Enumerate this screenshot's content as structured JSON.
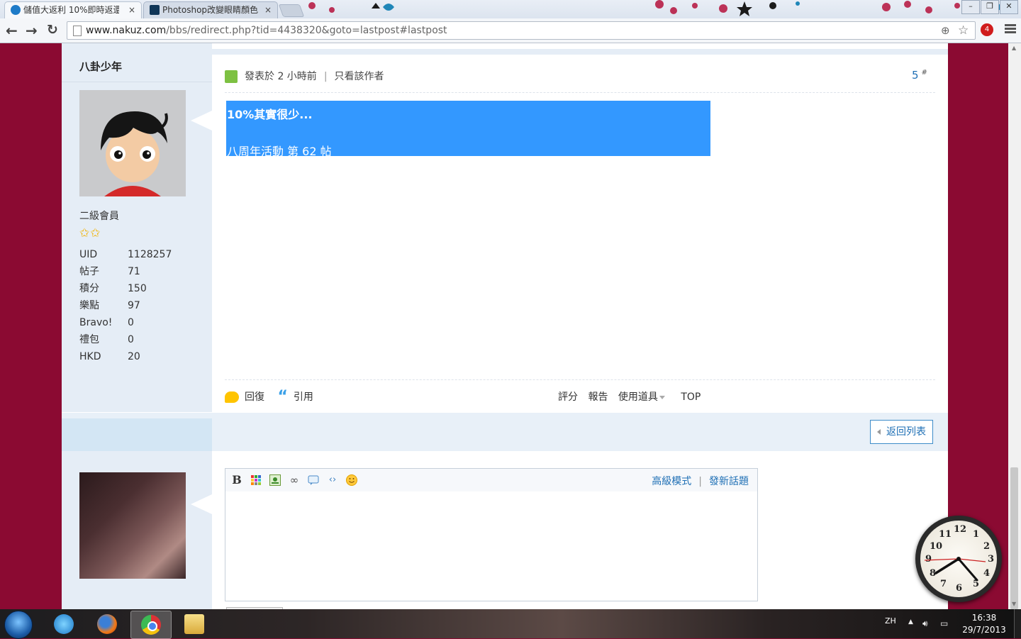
{
  "browser": {
    "tabs": [
      {
        "label": "儲值大返利 10%即時返還",
        "close": "×"
      },
      {
        "label": "Photoshop改變眼睛顏色",
        "close": "×"
      }
    ],
    "window_buttons": {
      "minimize": "–",
      "restore": "❐",
      "close": "✕"
    },
    "url_host": "www.nakuz.com",
    "url_path": "/bbs/redirect.php?tid=4438320&goto=lastpost#lastpost",
    "extension_badge": "4"
  },
  "post": {
    "author": "八卦少年",
    "rank": "二級會員",
    "stars": "✩✩",
    "stats": [
      {
        "key": "UID",
        "value": "1128257"
      },
      {
        "key": "帖子",
        "value": "71"
      },
      {
        "key": "積分",
        "value": "150"
      },
      {
        "key": "樂點",
        "value": "97"
      },
      {
        "key": "Bravo!",
        "value": "0"
      },
      {
        "key": "禮包",
        "value": "0"
      },
      {
        "key": "HKD",
        "value": "20"
      }
    ],
    "posted_at": "發表於 2 小時前",
    "only_author": "只看該作者",
    "floor": "5",
    "floor_mark": "#",
    "body_line1": "10%其實很少...",
    "body_line2": "八周年活動 第 62 帖",
    "actions_left": {
      "reply": "回復",
      "quote": "引用"
    },
    "actions_right": {
      "rate": "評分",
      "report": "報告",
      "tools": "使用道具",
      "top": "TOP"
    }
  },
  "back_to_list": "返回列表",
  "editor": {
    "advanced": "高級模式",
    "new_topic": "發新話題",
    "bold_label": "B"
  },
  "clock_numbers": [
    "12",
    "1",
    "2",
    "3",
    "4",
    "5",
    "6",
    "7",
    "8",
    "9",
    "10",
    "11"
  ],
  "taskbar": {
    "lang": "ZH",
    "time": "16:38",
    "date": "29/7/2013"
  },
  "colors": {
    "background": "#8b0a32",
    "highlight": "#3398ff",
    "link": "#1e6fb5",
    "sidebar": "#e5edf6"
  }
}
